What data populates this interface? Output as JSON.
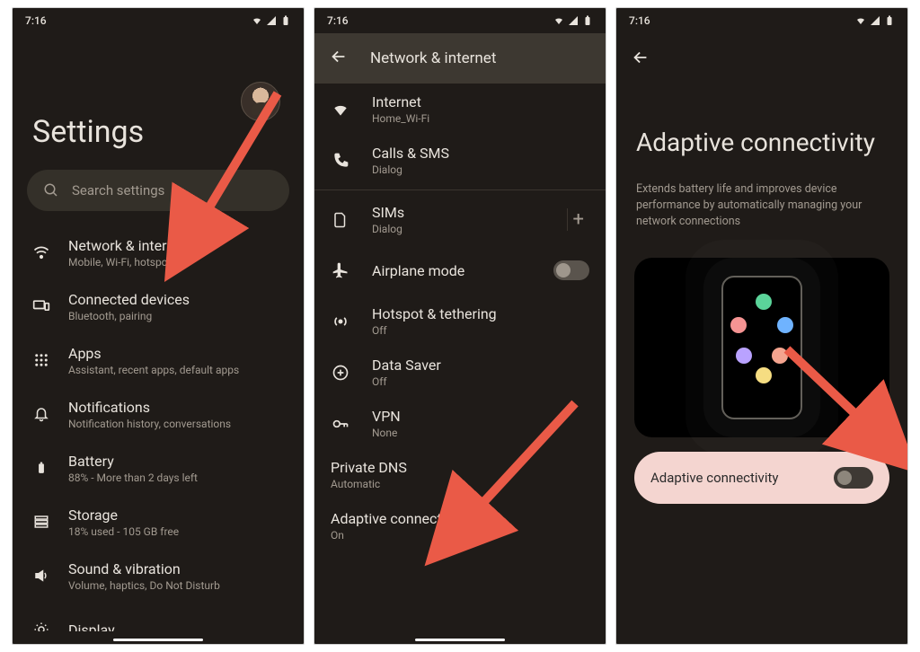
{
  "status": {
    "time": "7:16"
  },
  "screen1": {
    "title": "Settings",
    "search_placeholder": "Search settings",
    "items": [
      {
        "label": "Network & internet",
        "sub": "Mobile, Wi-Fi, hotspot"
      },
      {
        "label": "Connected devices",
        "sub": "Bluetooth, pairing"
      },
      {
        "label": "Apps",
        "sub": "Assistant, recent apps, default apps"
      },
      {
        "label": "Notifications",
        "sub": "Notification history, conversations"
      },
      {
        "label": "Battery",
        "sub": "88% - More than 2 days left"
      },
      {
        "label": "Storage",
        "sub": "18% used - 105 GB free"
      },
      {
        "label": "Sound & vibration",
        "sub": "Volume, haptics, Do Not Disturb"
      },
      {
        "label": "Display",
        "sub": ""
      }
    ]
  },
  "screen2": {
    "title": "Network & internet",
    "items": [
      {
        "label": "Internet",
        "sub": "Home_Wi-Fi"
      },
      {
        "label": "Calls & SMS",
        "sub": "Dialog"
      },
      {
        "label": "SIMs",
        "sub": "Dialog"
      },
      {
        "label": "Airplane mode",
        "sub": ""
      },
      {
        "label": "Hotspot & tethering",
        "sub": "Off"
      },
      {
        "label": "Data Saver",
        "sub": "Off"
      },
      {
        "label": "VPN",
        "sub": "None"
      },
      {
        "label": "Private DNS",
        "sub": "Automatic"
      },
      {
        "label": "Adaptive connectivity",
        "sub": "On"
      }
    ]
  },
  "screen3": {
    "title": "Adaptive connectivity",
    "desc": "Extends battery life and improves device performance by automatically managing your network connections",
    "switch_label": "Adaptive connectivity"
  }
}
